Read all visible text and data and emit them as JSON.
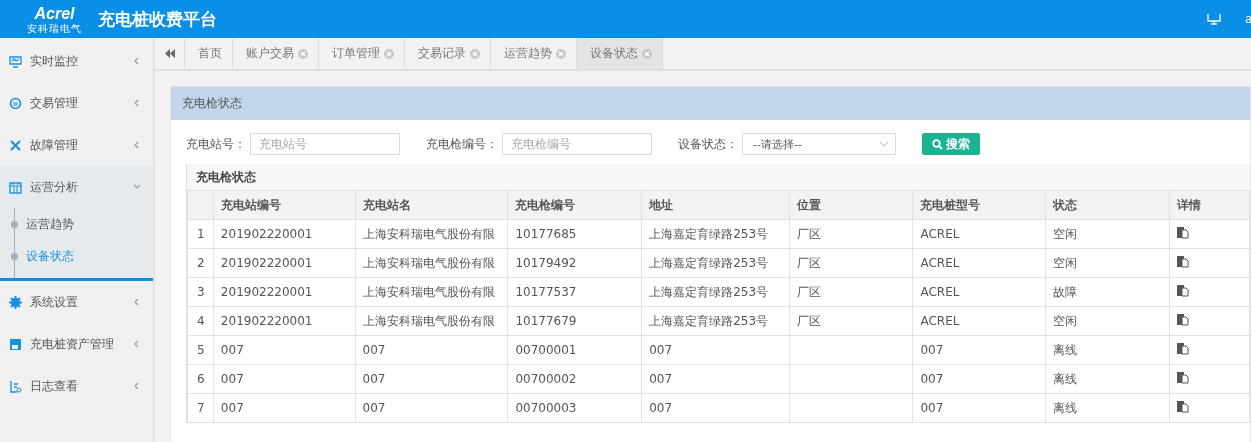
{
  "header": {
    "logo_text": "Acrel",
    "logo_subtitle": "安科瑞电气",
    "title": "充电桩收费平台",
    "user": "a"
  },
  "sidebar": {
    "items": [
      {
        "label": "实时监控",
        "expanded": false
      },
      {
        "label": "交易管理",
        "expanded": false
      },
      {
        "label": "故障管理",
        "expanded": false
      },
      {
        "label": "运营分析",
        "expanded": true,
        "children": [
          {
            "label": "运营趋势",
            "selected": false
          },
          {
            "label": "设备状态",
            "selected": true
          }
        ]
      },
      {
        "label": "系统设置",
        "expanded": false
      },
      {
        "label": "充电桩资产管理",
        "expanded": false
      },
      {
        "label": "日志查看",
        "expanded": false
      }
    ]
  },
  "tabs": [
    {
      "label": "首页",
      "closable": false,
      "selected": false
    },
    {
      "label": "账户交易",
      "closable": true,
      "selected": false
    },
    {
      "label": "订单管理",
      "closable": true,
      "selected": false
    },
    {
      "label": "交易记录",
      "closable": true,
      "selected": false
    },
    {
      "label": "运营趋势",
      "closable": true,
      "selected": false
    },
    {
      "label": "设备状态",
      "closable": true,
      "selected": true
    }
  ],
  "panel": {
    "title": "充电枪状态",
    "filters": [
      {
        "kind": "input",
        "label": "充电站号：",
        "placeholder": "充电站号"
      },
      {
        "kind": "input",
        "label": "充电枪编号：",
        "placeholder": "充电枪编号"
      },
      {
        "kind": "select",
        "label": "设备状态：",
        "value": "--请选择--"
      }
    ],
    "search_button": "搜索",
    "table": {
      "title": "充电枪状态",
      "columns": [
        "充电站编号",
        "充电站名",
        "充电枪编号",
        "地址",
        "位置",
        "充电桩型号",
        "状态",
        "详情"
      ],
      "rows": [
        {
          "index": "1",
          "cells": [
            "201902220001",
            "上海安科瑞电气股份有限",
            "10177685",
            "上海嘉定育绿路253号",
            "厂区",
            "ACREL",
            "空闲"
          ]
        },
        {
          "index": "2",
          "cells": [
            "201902220001",
            "上海安科瑞电气股份有限",
            "10179492",
            "上海嘉定育绿路253号",
            "厂区",
            "ACREL",
            "空闲"
          ]
        },
        {
          "index": "3",
          "cells": [
            "201902220001",
            "上海安科瑞电气股份有限",
            "10177537",
            "上海嘉定育绿路253号",
            "厂区",
            "ACREL",
            "故障"
          ]
        },
        {
          "index": "4",
          "cells": [
            "201902220001",
            "上海安科瑞电气股份有限",
            "10177679",
            "上海嘉定育绿路253号",
            "厂区",
            "ACREL",
            "空闲"
          ]
        },
        {
          "index": "5",
          "cells": [
            "007",
            "007",
            "00700001",
            "007",
            "",
            "007",
            "离线"
          ]
        },
        {
          "index": "6",
          "cells": [
            "007",
            "007",
            "00700002",
            "007",
            "",
            "007",
            "离线"
          ]
        },
        {
          "index": "7",
          "cells": [
            "007",
            "007",
            "00700003",
            "007",
            "",
            "007",
            "离线"
          ]
        }
      ]
    }
  }
}
